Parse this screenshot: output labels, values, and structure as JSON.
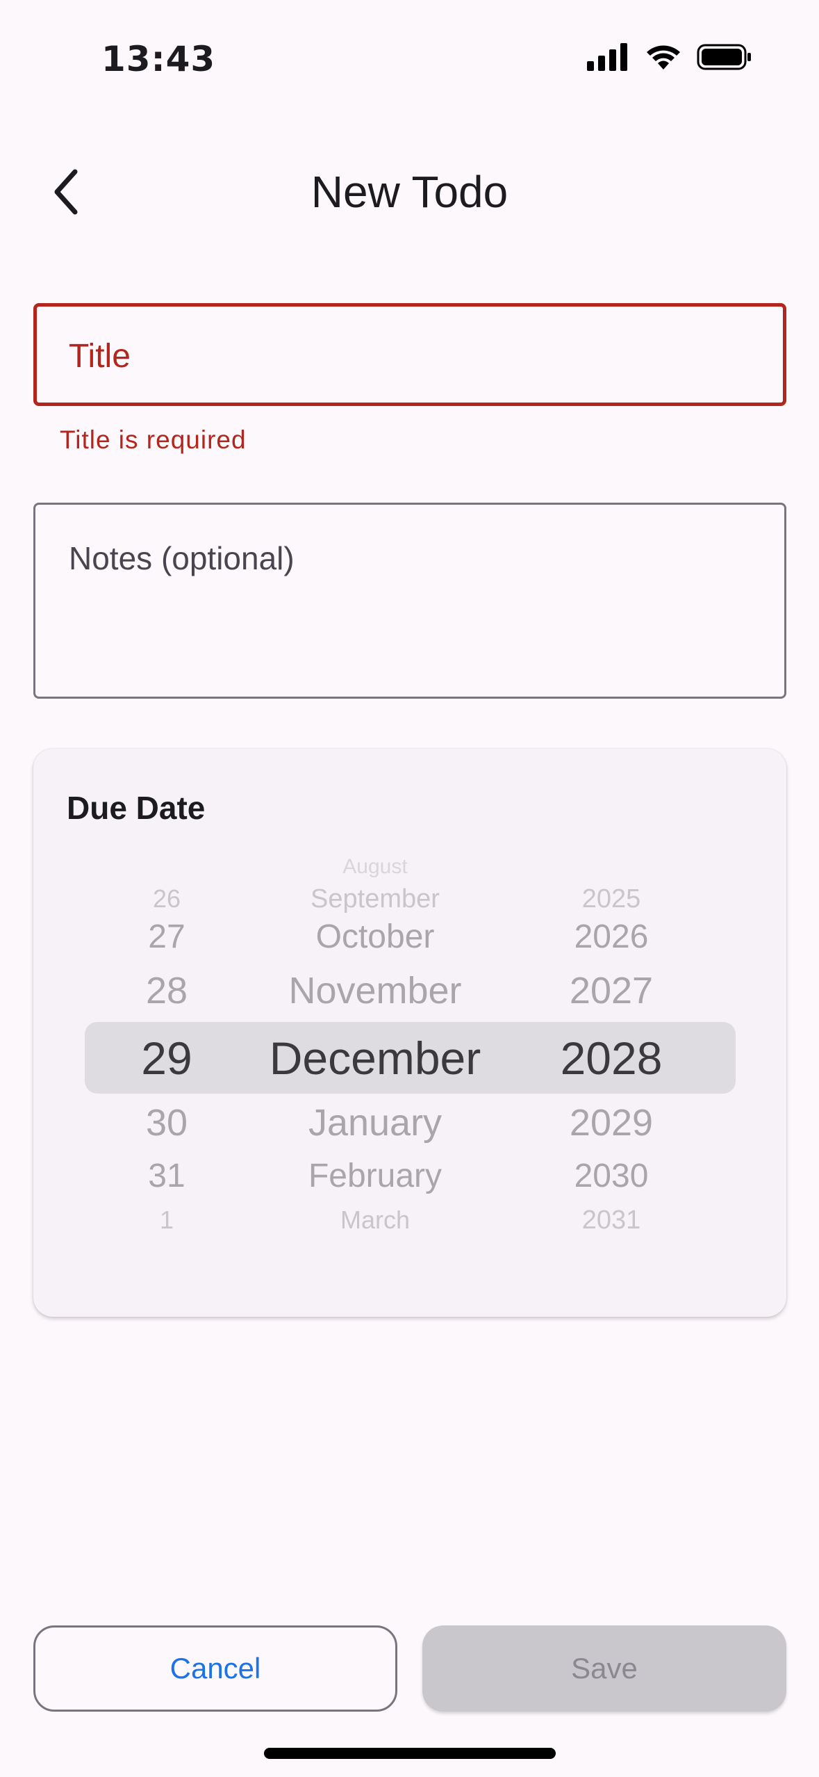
{
  "status_bar": {
    "time": "13:43"
  },
  "app_bar": {
    "title": "New Todo",
    "back_icon": "chevron-left-icon"
  },
  "form": {
    "title_field": {
      "placeholder": "Title",
      "value": "",
      "error": "Title is required"
    },
    "notes_field": {
      "placeholder": "Notes (optional)",
      "value": ""
    }
  },
  "due_date": {
    "label": "Due Date",
    "day": {
      "items": [
        "26",
        "27",
        "28",
        "29",
        "30",
        "31",
        "1"
      ],
      "selected": "29"
    },
    "month": {
      "items": [
        "August",
        "September",
        "October",
        "November",
        "December",
        "January",
        "February",
        "March"
      ],
      "selected": "December"
    },
    "year": {
      "items": [
        "2025",
        "2026",
        "2027",
        "2028",
        "2029",
        "2030",
        "2031"
      ],
      "selected": "2028"
    }
  },
  "actions": {
    "cancel_label": "Cancel",
    "save_label": "Save"
  },
  "colors": {
    "error": "#b3261e",
    "link": "#1a73e8",
    "disabled_bg": "#c9c7cc"
  }
}
